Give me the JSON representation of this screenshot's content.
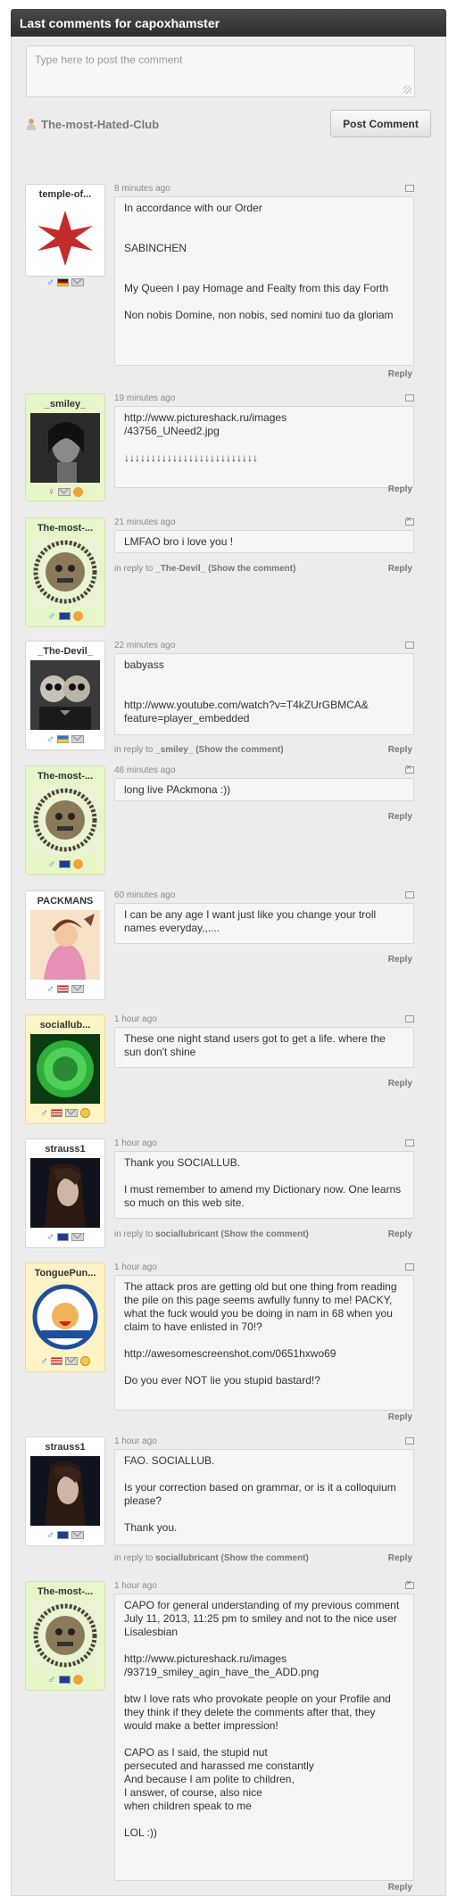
{
  "header": {
    "title": "Last comments for capoxhamster"
  },
  "composer": {
    "placeholder": "Type here to post the comment",
    "club_name": "The-most-Hated-Club",
    "post_label": "Post Comment"
  },
  "reply_label": "Reply",
  "comments": [
    {
      "user": "temple-of...",
      "time": "8 minutes ago",
      "text": "In accordance with our Order\n\n\nSABINCHEN\n\n\nMy Queen I pay Homage and Fealty from this day Forth\n\nNon nobis Domine, non nobis, sed nomini tuo da gloriam",
      "in_reply": "",
      "reply_target": "",
      "show": ""
    },
    {
      "user": "_smiley_",
      "time": "19 minutes ago",
      "text": "http://www.pictureshack.ru/images\n/43756_UNeed2.jpg\n\n↓↓↓↓↓↓↓↓↓↓↓↓↓↓↓↓↓↓↓↓↓↓↓↓↓",
      "in_reply": "",
      "reply_target": "",
      "show": ""
    },
    {
      "user": "The-most-...",
      "time": "21 minutes ago",
      "text": "LMFAO bro i love you !",
      "in_reply": "in reply to",
      "reply_target": "_The-Devil_",
      "show": "(Show the comment)"
    },
    {
      "user": "_The-Devil_",
      "time": "22 minutes ago",
      "text": "babyass\n\n\nhttp://www.youtube.com/watch?v=T4kZUrGBMCA&\nfeature=player_embedded",
      "in_reply": "in reply to",
      "reply_target": "_smiley_",
      "show": "(Show the comment)"
    },
    {
      "user": "The-most-...",
      "time": "46 minutes ago",
      "text": "long live PAckmona :))",
      "in_reply": "",
      "reply_target": "",
      "show": ""
    },
    {
      "user": "PACKMANS",
      "time": "60 minutes ago",
      "text": "I can be any age I want just like you change your troll names everyday,,....",
      "in_reply": "",
      "reply_target": "",
      "show": ""
    },
    {
      "user": "sociallub...",
      "time": "1 hour ago",
      "text": "These one night stand users got to get a life. where the sun don't shine",
      "in_reply": "",
      "reply_target": "",
      "show": ""
    },
    {
      "user": "strauss1",
      "time": "1 hour ago",
      "text": "Thank you SOCIALLUB.\n\nI must remember to amend my Dictionary now. One learns so much on this web site.",
      "in_reply": "in reply to",
      "reply_target": "sociallubricant",
      "show": "(Show the comment)"
    },
    {
      "user": "TonguePun...",
      "time": "1 hour ago",
      "text": "The attack pros are getting old but one thing from reading the pile on this page seems awfully funny to me! PACKY, what the fuck would you be doing in nam in 68 when you claim to have enlisted in 70!?\n\nhttp://awesomescreenshot.com/0651hxwo69\n\nDo you ever NOT lie you stupid bastard!?",
      "in_reply": "",
      "reply_target": "",
      "show": ""
    },
    {
      "user": "strauss1",
      "time": "1 hour ago",
      "text": "FAO. SOCIALLUB.\n\nIs your correction based on grammar, or is it a colloquium please?\n\nThank you.",
      "in_reply": "in reply to",
      "reply_target": "sociallubricant",
      "show": "(Show the comment)"
    },
    {
      "user": "The-most-...",
      "time": "1 hour ago",
      "text": "CAPO for general understanding of my previous comment\nJuly 11, 2013, 11:25 pm to smiley and not to the nice user Lisalesbian\n\nhttp://www.pictureshack.ru/images\n/93719_smiley_agin_have_the_ADD.png\n\nbtw I love rats who provokate people on your Profile and they think if they delete the comments after that, they would make a better impression!\n\nCAPO as I said, the stupid nut\npersecuted and harassed me constantly\nAnd because I am polite to children,\nI answer, of course, also nice\nwhen children speak to me\n\nLOL :))",
      "in_reply": "",
      "reply_target": "",
      "show": ""
    }
  ]
}
